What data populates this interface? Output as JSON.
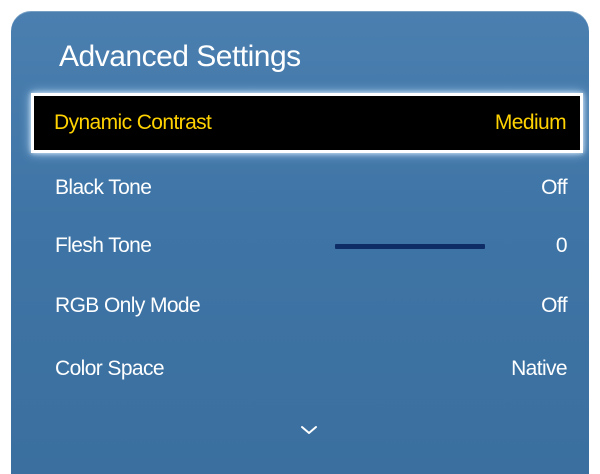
{
  "menu": {
    "title": "Advanced Settings",
    "items": [
      {
        "label": "Dynamic Contrast",
        "value": "Medium"
      },
      {
        "label": "Black Tone",
        "value": "Off"
      },
      {
        "label": "Flesh Tone",
        "value": "0",
        "slider_level": 0.5
      },
      {
        "label": "RGB Only Mode",
        "value": "Off"
      },
      {
        "label": "Color Space",
        "value": "Native"
      }
    ],
    "scroll_indicator_icon": "chevron-down-icon"
  },
  "colors": {
    "panel_background": "#4079aa",
    "focus_background": "#000000",
    "focus_text": "#ffd200",
    "text": "#ffffff",
    "slider_track": "#0e2c66"
  }
}
